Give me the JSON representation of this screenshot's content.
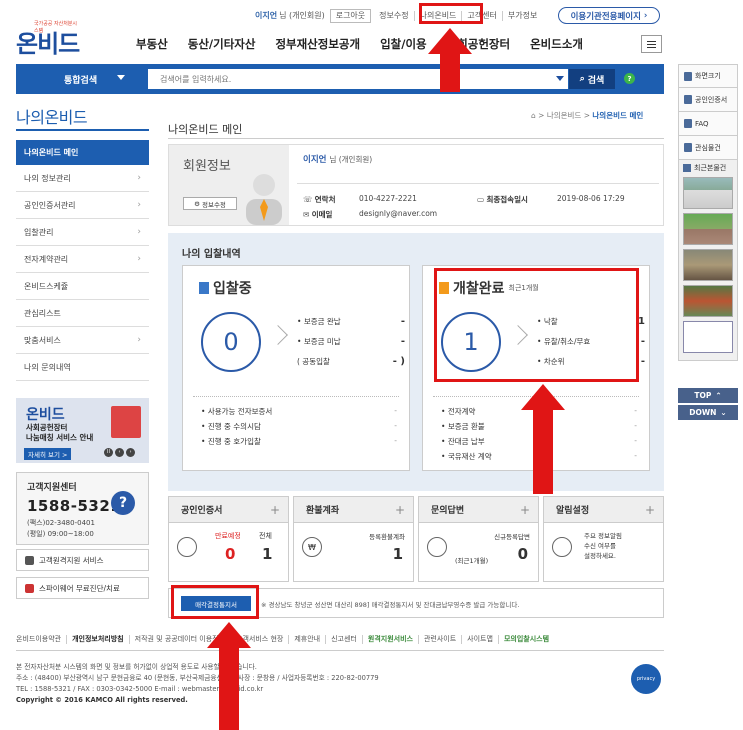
{
  "util": {
    "user_name": "이지언",
    "user_suffix": "님",
    "user_type": "(개인회원)",
    "logout": "로그아웃",
    "edit_info": "정보수정",
    "my_onbid": "나의온비드",
    "customer": "고객센터",
    "extra": "부가정보",
    "agency": "이용기관전용페이지"
  },
  "logo": {
    "text": "온비드",
    "tag": "국가공공 자산처분시스템"
  },
  "gnb": [
    "부동산",
    "동산/기타자산",
    "정부재산정보공개",
    "입찰/이용",
    "사회공헌장터",
    "온비드소개"
  ],
  "search": {
    "label": "통합검색",
    "placeholder": "검색어를 입력하세요.",
    "button": "검색",
    "help": "?"
  },
  "quick": {
    "items": [
      "화면크기",
      "공인인증서",
      "FAQ",
      "관심물건"
    ],
    "recent": "최근본물건",
    "top": "TOP",
    "down": "DOWN"
  },
  "left": {
    "title": "나의온비드",
    "items": [
      "나의온비드 메인",
      "나의 정보관리",
      "공인인증서관리",
      "입찰관리",
      "전자계약관리",
      "온비드스케쥴",
      "관심리스트",
      "맞춤서비스",
      "나의 문의내역"
    ],
    "banner": {
      "title": "온비드",
      "line1": "사회공헌장터",
      "line2": "나눔매칭 서비스 안내",
      "more": "자세히 보기 >"
    },
    "cc": {
      "title": "고객지원센터",
      "phone": "1588-5321",
      "fax": "(팩스)02-3480-0401",
      "hours": "(평일) 09:00~18:00"
    },
    "btn1": "고객원격지원 서비스",
    "btn2": "스파이웨어 무료진단/치료"
  },
  "main": {
    "title": "나의온비드 메인",
    "crumb_home": "HOME",
    "crumb_mid": "나의온비드",
    "crumb_cur": "나의온비드 메인",
    "member": {
      "title": "회원정보",
      "edit": "정보수정",
      "name": "이지언",
      "suffix": "님 (개인회원)",
      "phone_k": "연락처",
      "phone": "010-4227-2221",
      "email_k": "이메일",
      "email": "designly@naver.com",
      "last_k": "최종접속일시",
      "last": "2019-08-06 17:29"
    },
    "bid": {
      "title": "나의 입찰내역",
      "left": {
        "head": "입찰중",
        "count": "0",
        "rows": [
          [
            "보증금 완납",
            "-"
          ],
          [
            "보증금 미납",
            "-"
          ],
          [
            "( 공동입찰",
            "- )"
          ]
        ],
        "ext": [
          [
            "사용가능 전자보증서",
            "-"
          ],
          [
            "진행 중 수의시담",
            "-"
          ],
          [
            "진행 중 호가입찰",
            "-"
          ]
        ]
      },
      "right": {
        "head": "개찰완료",
        "sub": "최근1개월",
        "count": "1",
        "rows": [
          [
            "낙찰",
            "1"
          ],
          [
            "유찰/취소/무효",
            "-"
          ],
          [
            "차순위",
            "-"
          ]
        ],
        "ext": [
          [
            "전자계약",
            "-"
          ],
          [
            "보증금 환불",
            "-"
          ],
          [
            "잔대금 납부",
            "-"
          ],
          [
            "국유재산 계약",
            "-"
          ]
        ]
      }
    },
    "tiles": [
      {
        "title": "공인인증서",
        "a_label": "만료예정",
        "a_val": "0",
        "b_label": "전체",
        "b_val": "1"
      },
      {
        "title": "환불계좌",
        "label": "등록환불계좌",
        "val": "1"
      },
      {
        "title": "문의답변",
        "label": "신규등록답변",
        "sub": "(최근1개월)",
        "val": "0"
      },
      {
        "title": "알림설정",
        "line1": "주요 정보알림",
        "line2": "수신 여부를",
        "line3": "설정하세요."
      }
    ],
    "bottom": {
      "button": "매각결정통지서",
      "text": "※ 경상남도 창녕군 성산면 대산리 898] 매각결정통지서 및 잔대금납부영수증 발급 가능합니다."
    }
  },
  "footer": {
    "nav": [
      "온비드이용약관",
      "개인정보처리방침",
      "저작권 및 공공데이터 이용정책",
      "고객서비스 현장",
      "제휴안내",
      "신고센터",
      "원격지원서비스",
      "관련사이트",
      "사이트맵",
      "모의입찰시스템"
    ],
    "l1": "본 전자자산처분 시스템의 화면 및 정보를 허가없이 상업적 용도로 사용할 수 없습니다.",
    "l2": "주소 : (48400) 부산광역시 남구 문현금융로 40 (문현동, 부산국제금융센터) / 사장 : 문창용 / 사업자등록번호 : 220-82-00779",
    "l3": "TEL : 1588-5321 / FAX : 0303-0342-5000 E-mail : webmaster@onbid.co.kr",
    "copy": "Copyright © 2016 KAMCO All rights reserved.",
    "cert": "privacy"
  },
  "colors": {
    "primary": "#1d5eb0",
    "accent": "#e01515"
  }
}
